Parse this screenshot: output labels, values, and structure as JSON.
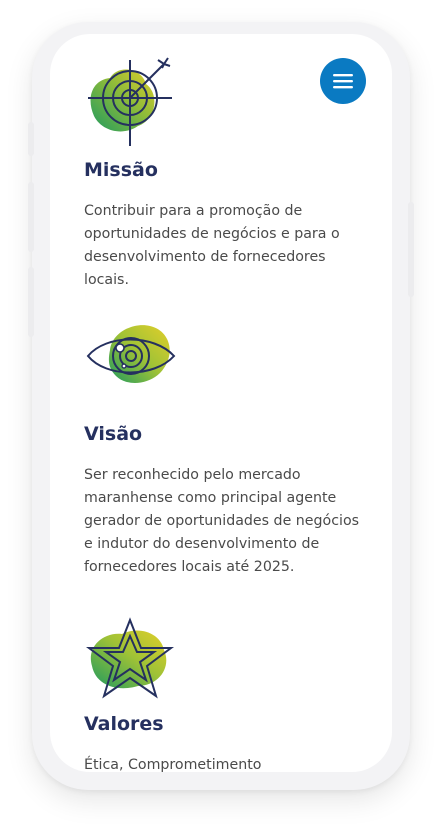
{
  "menu": {
    "icon": "hamburger-menu-icon",
    "accent": "#0a7ac2"
  },
  "sections": [
    {
      "icon": "target-icon",
      "title": "Missão",
      "text": "Contribuir para a promoção de oportunidades de negócios e para o desenvolvimento de fornecedores locais."
    },
    {
      "icon": "eye-icon",
      "title": "Visão",
      "text": "Ser reconhecido pelo mercado maranhense como principal agente gerador de oportunidades de negócios e indutor do desenvolvimento de fornecedores locais até 2025."
    },
    {
      "icon": "star-icon",
      "title": "Valores",
      "text": "Ética, Comprometimento"
    }
  ],
  "colors": {
    "title": "#25305f",
    "body": "#4a4a4a",
    "icon_green": "#1f9a5f",
    "icon_yellow": "#d6cc2c"
  }
}
